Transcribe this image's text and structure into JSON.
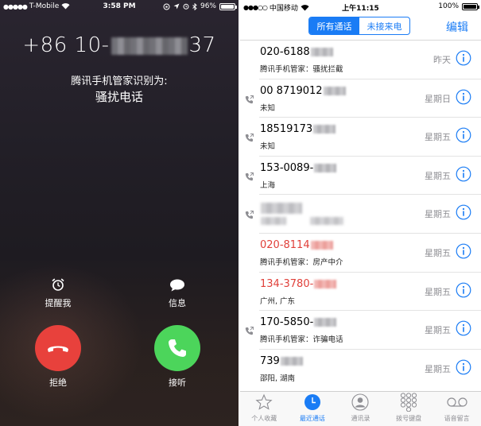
{
  "call_screen": {
    "status_bar": {
      "carrier": "T-Mobile",
      "time": "3:58 PM",
      "battery": "96%"
    },
    "number_prefix": "+86 10-",
    "number_suffix": "37",
    "identified_label": "腾讯手机管家识别为:",
    "identified_type": "骚扰电话",
    "remind_label": "提醒我",
    "message_label": "信息",
    "decline_label": "拒绝",
    "accept_label": "接听",
    "colors": {
      "decline": "#e8413c",
      "accept": "#4cd55b"
    }
  },
  "recents_screen": {
    "status_bar": {
      "carrier": "中国移动",
      "time": "上午11:15",
      "battery": "100%"
    },
    "segment_all": "所有通话",
    "segment_missed": "未接来电",
    "edit_label": "编辑",
    "rows": [
      {
        "number": "020-6188",
        "subtitle": "腾讯手机管家：骚扰拦截",
        "date": "昨天",
        "missed": false,
        "outgoing": false
      },
      {
        "number": "00 8719012",
        "subtitle": "未知",
        "date": "星期日",
        "missed": false,
        "outgoing": true
      },
      {
        "number": "18519173",
        "subtitle": "未知",
        "date": "星期五",
        "missed": false,
        "outgoing": true
      },
      {
        "number": "153-0089-",
        "subtitle": "上海",
        "date": "星期五",
        "missed": false,
        "outgoing": true
      },
      {
        "number": "",
        "subtitle": "",
        "date": "星期五",
        "missed": false,
        "outgoing": true
      },
      {
        "number": "020-8114",
        "subtitle": "腾讯手机管家：房产中介",
        "date": "星期五",
        "missed": true,
        "outgoing": false
      },
      {
        "number": "134-3780-",
        "subtitle": "广州, 广东",
        "date": "星期五",
        "missed": true,
        "outgoing": false
      },
      {
        "number": "170-5850-",
        "subtitle": "腾讯手机管家：诈骗电话",
        "date": "星期五",
        "missed": false,
        "outgoing": true
      },
      {
        "number": "739",
        "subtitle": "邵阳, 湖南",
        "date": "星期五",
        "missed": false,
        "outgoing": false
      }
    ],
    "tabs": [
      {
        "label": "个人收藏",
        "icon": "star-icon",
        "active": false
      },
      {
        "label": "最近通话",
        "icon": "clock-icon",
        "active": true
      },
      {
        "label": "通讯录",
        "icon": "contacts-icon",
        "active": false
      },
      {
        "label": "拨号键盘",
        "icon": "keypad-icon",
        "active": false
      },
      {
        "label": "语音留言",
        "icon": "voicemail-icon",
        "active": false
      }
    ],
    "colors": {
      "accent": "#1a7cf5",
      "missed": "#e0403a"
    }
  }
}
